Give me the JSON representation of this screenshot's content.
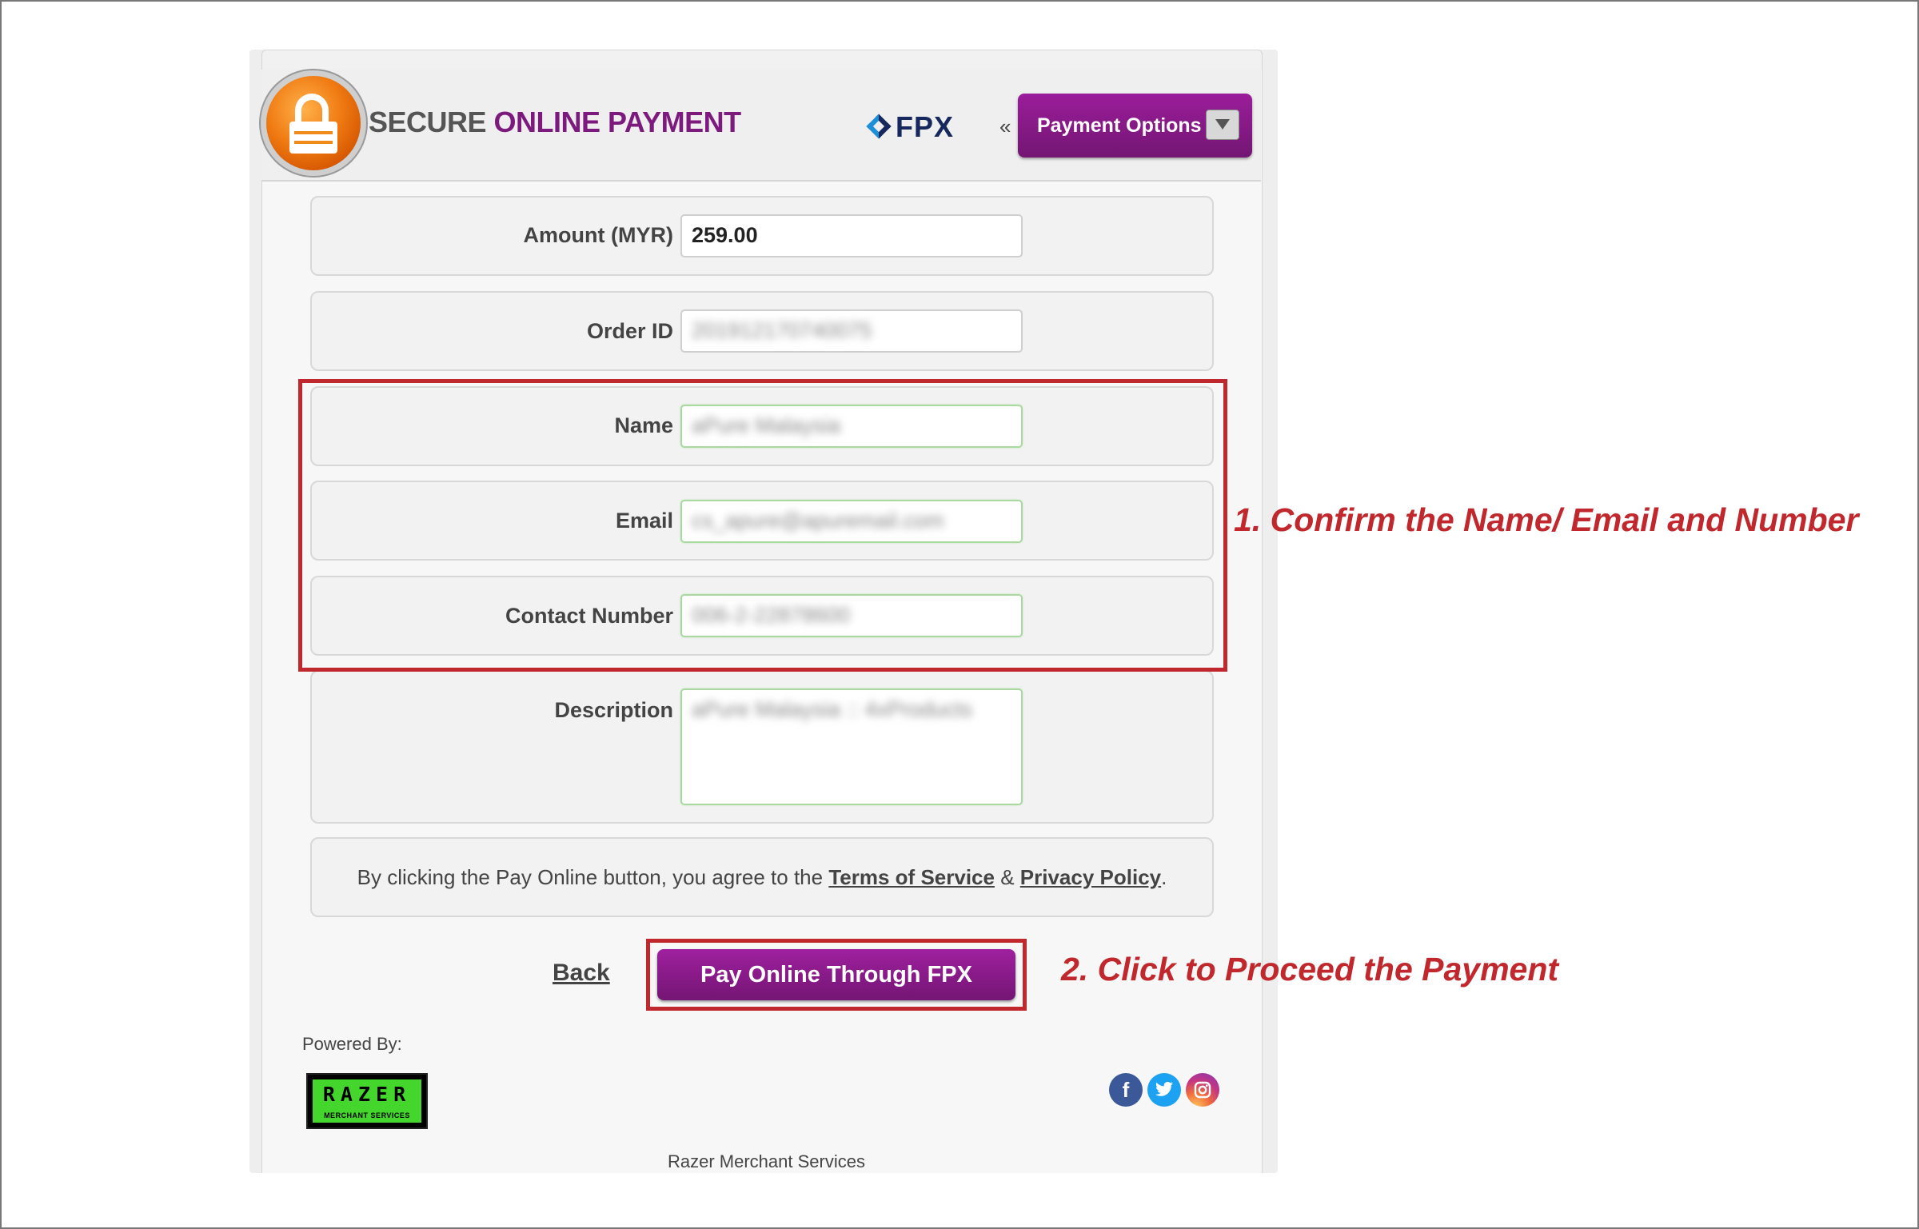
{
  "header": {
    "title_part1": "SECURE",
    "title_part2": "ONLINE PAYMENT",
    "fpx_logo": "FPX",
    "laquo": "«",
    "payment_options_label": "Payment Options"
  },
  "form": {
    "amount_label": "Amount (MYR)",
    "amount_value": "259.00",
    "order_label": "Order ID",
    "order_value": "201912170740075",
    "name_label": "Name",
    "name_value": "aPure Malaysia",
    "email_label": "Email",
    "email_value": "cs_apure@apuremail.com",
    "contact_label": "Contact Number",
    "contact_value": "006-2-22878600",
    "description_label": "Description",
    "description_value": "aPure Malaysia :: 4xProducts"
  },
  "agreement": {
    "prefix": "By clicking the Pay Online button, you agree to the",
    "terms_link": "Terms of Service",
    "amp": "&",
    "privacy_link": "Privacy Policy",
    "suffix": "."
  },
  "actions": {
    "back_label": "Back",
    "pay_label": "Pay Online Through FPX"
  },
  "annotations": {
    "note1": "1. Confirm the Name/ Email and Number",
    "note2": "2. Click to Proceed the Payment",
    "highlight_color": "#c1282d"
  },
  "footer": {
    "powered_by": "Powered By:",
    "razer_logo_top": "RAZER",
    "razer_logo_bottom": "MERCHANT SERVICES",
    "company": "Razer Merchant Services",
    "social_icons": [
      "facebook-icon",
      "twitter-icon",
      "instagram-icon"
    ]
  },
  "colors": {
    "brand_purple": "#7d1a7d",
    "lock_orange": "#f07a12",
    "razer_green": "#44d62c"
  }
}
